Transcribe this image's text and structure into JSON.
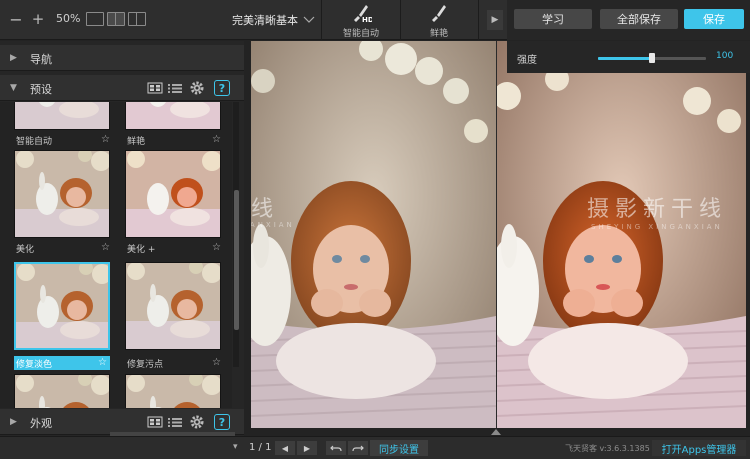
{
  "toolbar": {
    "zoom_level": "50%",
    "preset_title": "完美清晰基本",
    "tools": [
      {
        "label": "智能自动",
        "badge": "HD"
      },
      {
        "label": "鲜艳"
      }
    ],
    "learn_label": "学习",
    "save_all_label": "全部保存",
    "save_label": "保存"
  },
  "adjust": {
    "strength_label": "强度",
    "strength_value": "100",
    "strength_fraction": 0.5
  },
  "left": {
    "nav_title": "导航",
    "preset_title": "预设",
    "look_title": "外观",
    "help_glyph": "?",
    "presets": [
      {
        "label": "智能自动",
        "selected": false
      },
      {
        "label": "鲜艳",
        "selected": false
      },
      {
        "label": "美化",
        "selected": false
      },
      {
        "label": "美化 +",
        "selected": false
      },
      {
        "label": "修复淡色",
        "selected": true
      },
      {
        "label": "修复污点",
        "selected": false
      }
    ]
  },
  "watermark": {
    "text": "摄影新干线",
    "sub": "SHEYING XINGANXIAN",
    "sub_partial": "www.dt..."
  },
  "footer": {
    "page_count": "1 / 1",
    "sync_label": "同步设置",
    "version": "飞天贤客 v:3.6.3.1385",
    "apps_label": "打开Apps管理器"
  },
  "colors": {
    "accent": "#3ec5ea",
    "panel": "#262626",
    "toolbar": "#2e2e2e"
  }
}
